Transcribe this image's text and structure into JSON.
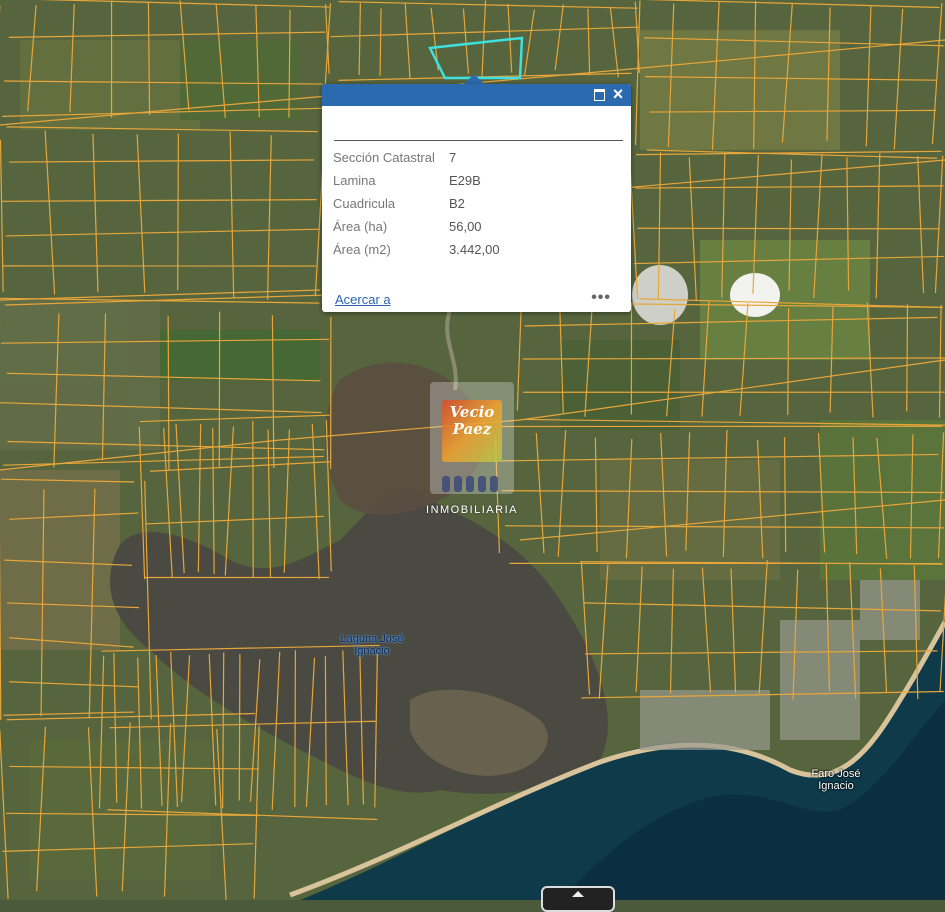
{
  "popup": {
    "title": "",
    "fields": [
      {
        "key": "Sección Catastral",
        "value": "7"
      },
      {
        "key": "Lamina",
        "value": "E29B"
      },
      {
        "key": "Cuadricula",
        "value": "B2"
      },
      {
        "key": "Área (ha)",
        "value": "56,00"
      },
      {
        "key": "Área (m2)",
        "value": "3.442,00"
      }
    ],
    "zoom_link": "Acercar a",
    "more_icon": "ellipsis-icon",
    "maximize_icon": "maximize-icon",
    "close_icon": "close-icon"
  },
  "map": {
    "labels": {
      "lagoon": [
        "Laguna José",
        "Ignacio"
      ],
      "lighthouse": [
        "Faro José",
        "Ignacio"
      ]
    },
    "parcel_line_color": "#e8a63a",
    "selected_parcel_color": "#3fe0e0",
    "sea_color": "#0e3a4a"
  },
  "watermark": {
    "script": [
      "Vecio",
      "Paez"
    ],
    "text": "INMOBILIARIA"
  }
}
